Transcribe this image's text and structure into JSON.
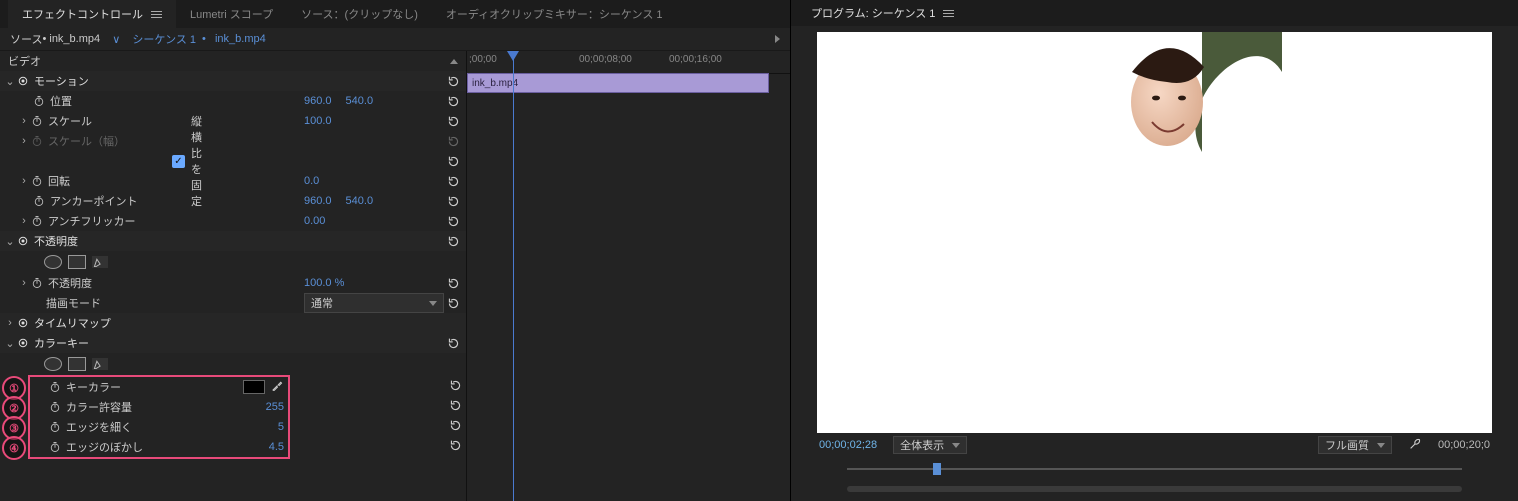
{
  "top_tabs": {
    "effect_controls": "エフェクトコントロール",
    "lumetri": "Lumetri スコープ",
    "source": "ソース：(クリップなし)",
    "audio_mixer": "オーディオクリップミキサー：シーケンス 1"
  },
  "subheader": {
    "source_label": "ソース",
    "clip": "ink_b.mp4",
    "sequence": "シーケンス 1",
    "sequence_clip": "ink_b.mp4"
  },
  "video_section": "ビデオ",
  "motion": {
    "label": "モーション",
    "position": {
      "label": "位置",
      "x": "960.0",
      "y": "540.0"
    },
    "scale": {
      "label": "スケール",
      "v": "100.0"
    },
    "scale_w": {
      "label": "スケール（幅）"
    },
    "aspect_lock": "縦横比を固定",
    "rotation": {
      "label": "回転",
      "v": "0.0"
    },
    "anchor": {
      "label": "アンカーポイント",
      "x": "960.0",
      "y": "540.0"
    },
    "antiflicker": {
      "label": "アンチフリッカー",
      "v": "0.00"
    }
  },
  "opacity": {
    "label": "不透明度",
    "value_label": "不透明度",
    "value": "100.0 %",
    "blend_label": "描画モード",
    "blend_value": "通常"
  },
  "timeremap": {
    "label": "タイムリマップ"
  },
  "colorkey": {
    "label": "カラーキー",
    "key_color": "キーカラー",
    "tolerance": {
      "label": "カラー許容量",
      "v": "255"
    },
    "edge_thin": {
      "label": "エッジを細く",
      "v": "5"
    },
    "edge_blur": {
      "label": "エッジのぼかし",
      "v": "4.5"
    }
  },
  "annotations": [
    "①",
    "②",
    "③",
    "④"
  ],
  "timeline": {
    "ticks": [
      ";00;00",
      "00;00;08;00",
      "00;00;16;00"
    ],
    "clip": "ink_b.mp4"
  },
  "program": {
    "title": "プログラム: シーケンス 1",
    "timecode": "00;00;02;28",
    "fit": "全体表示",
    "quality": "フル画質",
    "duration": "00;00;20;0"
  }
}
